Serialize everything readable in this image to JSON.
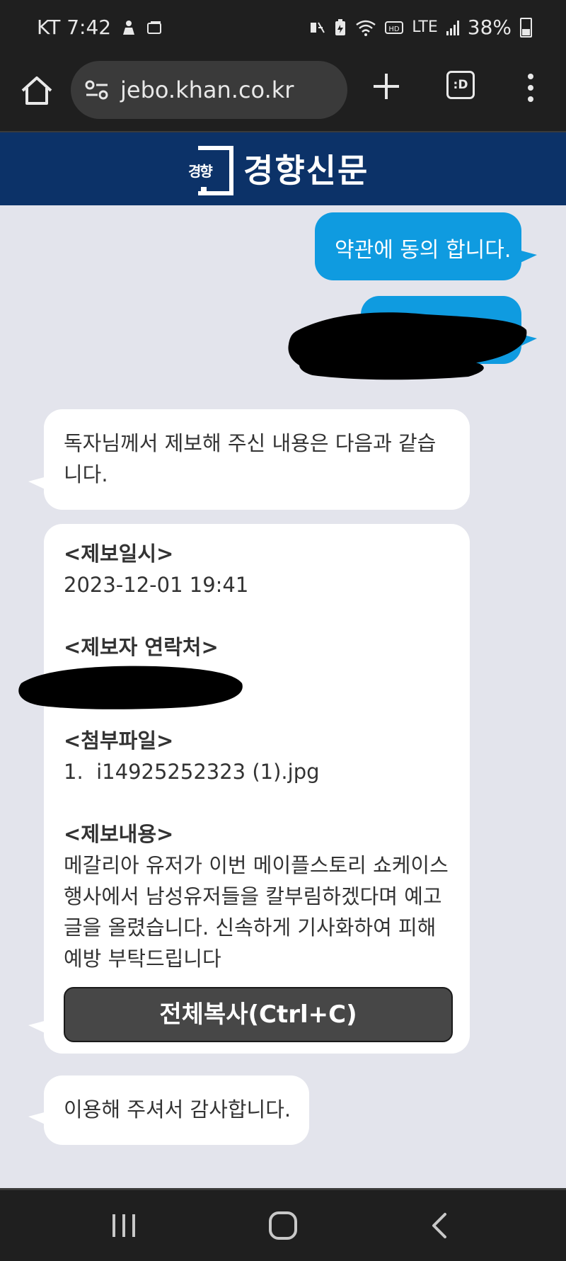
{
  "status_bar": {
    "time": "KT 7:42",
    "network": "LTE",
    "battery": "38%",
    "icons": [
      "notification-icon",
      "wallet-icon",
      "mute-icon",
      "battery-saver-icon",
      "wifi-icon",
      "hd-icon",
      "signal-icon",
      "battery-icon"
    ]
  },
  "browser": {
    "url": "jebo.khan.co.kr",
    "tabs_label": ":D"
  },
  "header": {
    "logo_mark": "경향",
    "logo_text": "경향신문",
    "bg_color": "#0c3268"
  },
  "chat": {
    "user_messages": [
      "약관에 동의 합니다."
    ],
    "intro_message": "독자님께서 제보해 주신 내용은 다음과 같습니다.",
    "report": {
      "date_title": "<제보일시>",
      "date_value": "2023-12-01 19:41",
      "contact_title": "<제보자 연락처>",
      "attachment_title": "<첨부파일>",
      "attachment_index": "1.",
      "attachment_name": "i14925252323 (1).jpg",
      "content_title": "<제보내용>",
      "content_text": "메갈리아 유저가 이번 메이플스토리 쇼케이스 행사에서 남성유저들을 칼부림하겠다며 예고글을 올렸습니다. 신속하게 기사화하여 피해예방 부탁드립니다",
      "copy_button": "전체복사(Ctrl+C)"
    },
    "closing_message": "이용해 주셔서 감사합니다.",
    "colors": {
      "outgoing": "#0f9be0",
      "incoming": "#ffffff",
      "background": "#e3e4ec"
    }
  },
  "nav": {
    "buttons": [
      "recent-apps",
      "home",
      "back"
    ]
  }
}
